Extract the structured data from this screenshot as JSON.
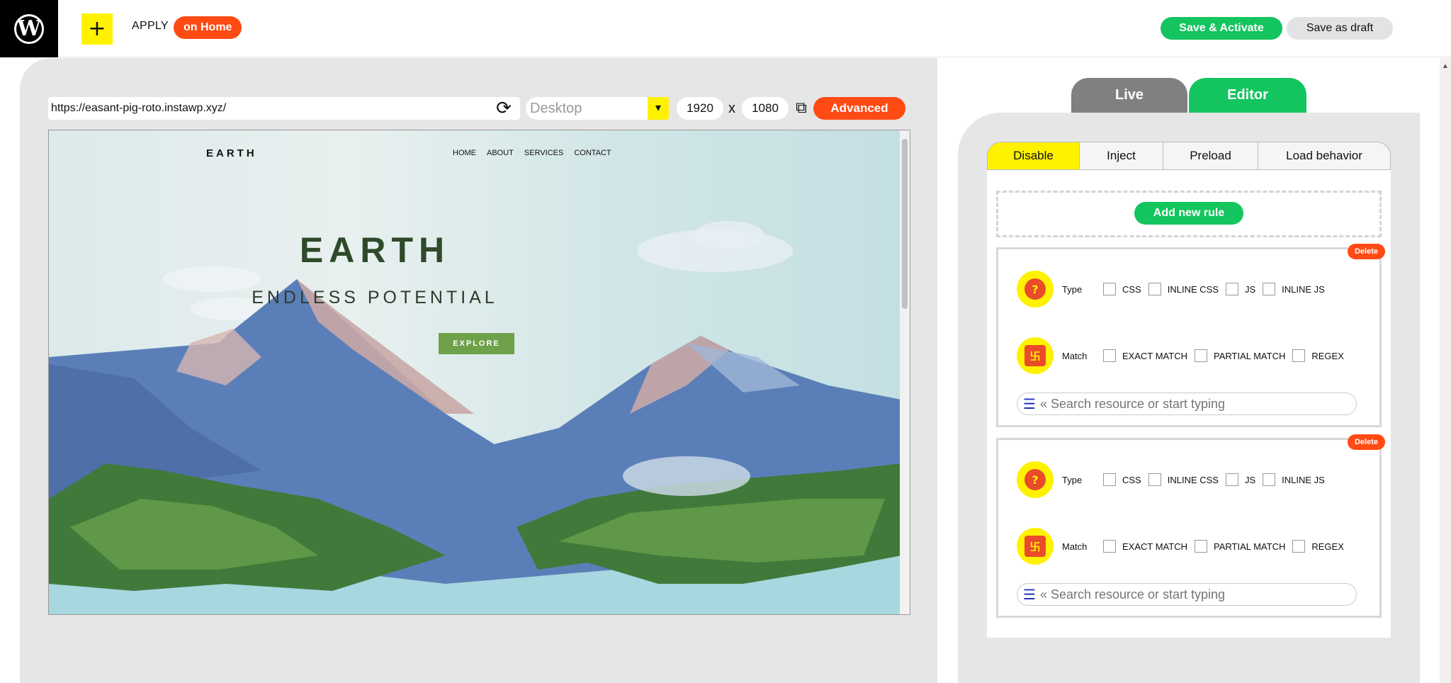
{
  "topbar": {
    "logo_glyph": "W",
    "plus_glyph": "+",
    "apply_label": "APPLY",
    "apply_target": "on Home",
    "save_activate": "Save & Activate",
    "save_draft": "Save as draft"
  },
  "preview": {
    "url": "https://easant-pig-roto.instawp.xyz/",
    "device": "Desktop",
    "width": "1920",
    "times": "x",
    "height": "1080",
    "advanced_label": "Advanced"
  },
  "site": {
    "logo": "EARTH",
    "nav": [
      "HOME",
      "ABOUT",
      "SERVICES",
      "CONTACT"
    ],
    "title": "EARTH",
    "subtitle": "ENDLESS POTENTIAL",
    "button": "EXPLORE"
  },
  "editor": {
    "top_tabs": [
      "Live",
      "Editor"
    ],
    "active_top_tab": "Editor",
    "subtabs": [
      "Disable",
      "Inject",
      "Preload",
      "Load behavior"
    ],
    "active_subtab": "Disable",
    "add_rule_label": "Add new rule",
    "rules": [
      {
        "delete_label": "Delete",
        "type_label": "Type",
        "type_options": [
          "CSS",
          "INLINE CSS",
          "JS",
          "INLINE JS"
        ],
        "match_label": "Match",
        "match_options": [
          "EXACT MATCH",
          "PARTIAL MATCH",
          "REGEX"
        ],
        "search_placeholder": "« Search resource or start typing"
      },
      {
        "delete_label": "Delete",
        "type_label": "Type",
        "type_options": [
          "CSS",
          "INLINE CSS",
          "JS",
          "INLINE JS"
        ],
        "match_label": "Match",
        "match_options": [
          "EXACT MATCH",
          "PARTIAL MATCH",
          "REGEX"
        ],
        "search_placeholder": "« Search resource or start typing"
      }
    ]
  },
  "colors": {
    "accent_green": "#14c45f",
    "accent_orange": "#ff4a14",
    "accent_yellow": "#fff200",
    "live_tab_gray": "#808080"
  }
}
